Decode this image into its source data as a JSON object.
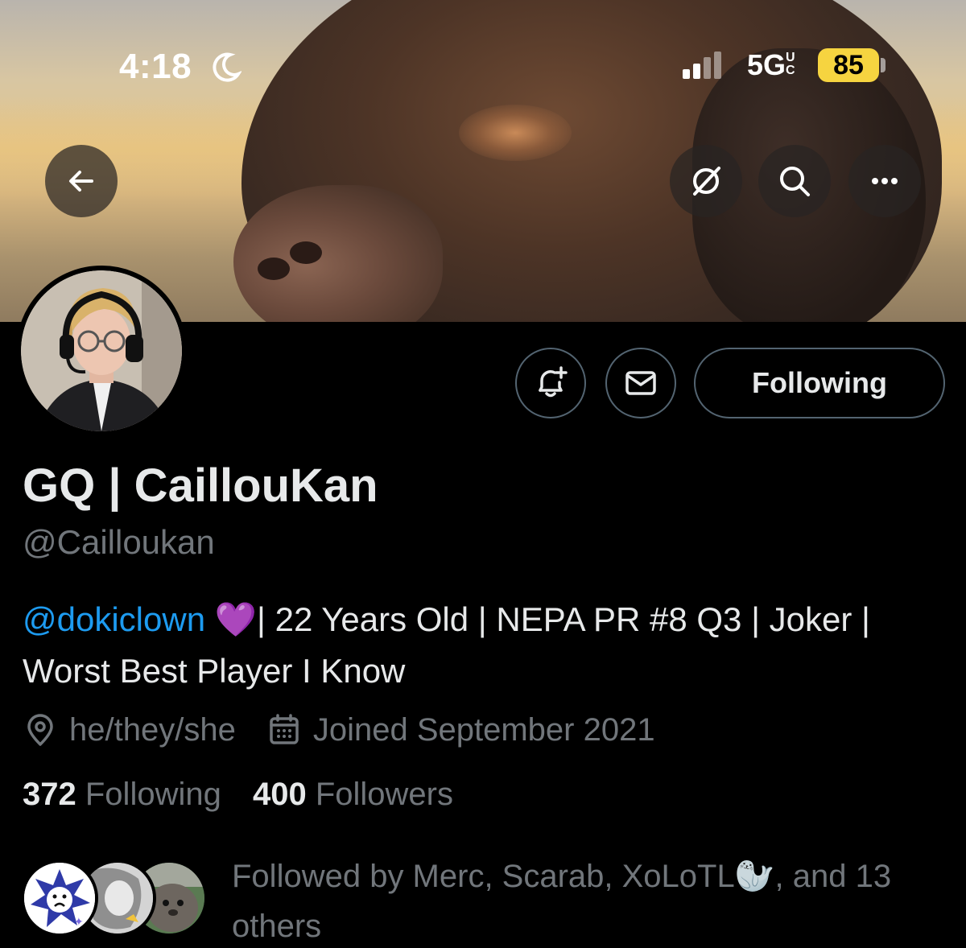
{
  "status_bar": {
    "time": "4:18",
    "network": "5G",
    "network_suffix": "UC",
    "battery": "85",
    "battery_color": "#f6d440"
  },
  "banner": {
    "back_icon": "arrow-left-icon",
    "grok_icon": "grok-icon",
    "search_icon": "search-icon",
    "more_icon": "more-icon"
  },
  "actions": {
    "notify_icon": "bell-plus-icon",
    "message_icon": "envelope-icon",
    "following_label": "Following"
  },
  "profile": {
    "display_name": "GQ | CaillouKan",
    "handle": "@Cailloukan",
    "bio_mention": "@dokiclown",
    "bio_emoji": "💜",
    "bio_text": "| 22 Years Old | NEPA PR #8 Q3 | Joker | Worst Best Player I Know",
    "location": "he/they/she",
    "joined": "Joined September 2021",
    "following_count": "372",
    "following_label": "Following",
    "followers_count": "400",
    "followers_label": "Followers",
    "followed_by": "Followed by Merc, Scarab, XoLoTL🦭, and 13 others"
  },
  "colors": {
    "accent": "#1d9bf0",
    "muted": "#71767b",
    "text": "#e7e9ea",
    "border": "#536471"
  }
}
